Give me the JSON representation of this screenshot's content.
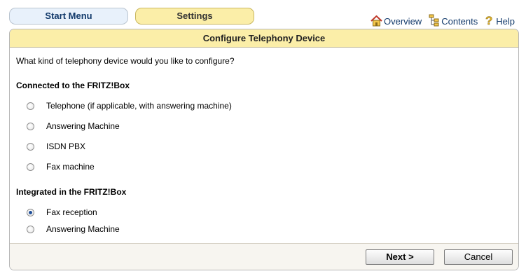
{
  "tabs": {
    "start_menu": "Start Menu",
    "settings": "Settings"
  },
  "toplinks": {
    "overview": "Overview",
    "contents": "Contents",
    "help": "Help"
  },
  "panel": {
    "title": "Configure Telephony Device",
    "question": "What kind of telephony device would you like to configure?",
    "section1": {
      "title": "Connected to the FRITZ!Box",
      "options": [
        "Telephone (if applicable, with answering machine)",
        "Answering Machine",
        "ISDN PBX",
        "Fax machine"
      ]
    },
    "section2": {
      "title": "Integrated in the FRITZ!Box",
      "options": [
        "Fax reception",
        "Answering Machine"
      ],
      "selected": "Fax reception"
    },
    "buttons": {
      "next": "Next >",
      "cancel": "Cancel"
    }
  },
  "colors": {
    "tab_blue": "#e8f1fb",
    "tab_yellow": "#fbeea8",
    "header_yellow": "#fbeea8",
    "link_blue": "#123a6b"
  }
}
